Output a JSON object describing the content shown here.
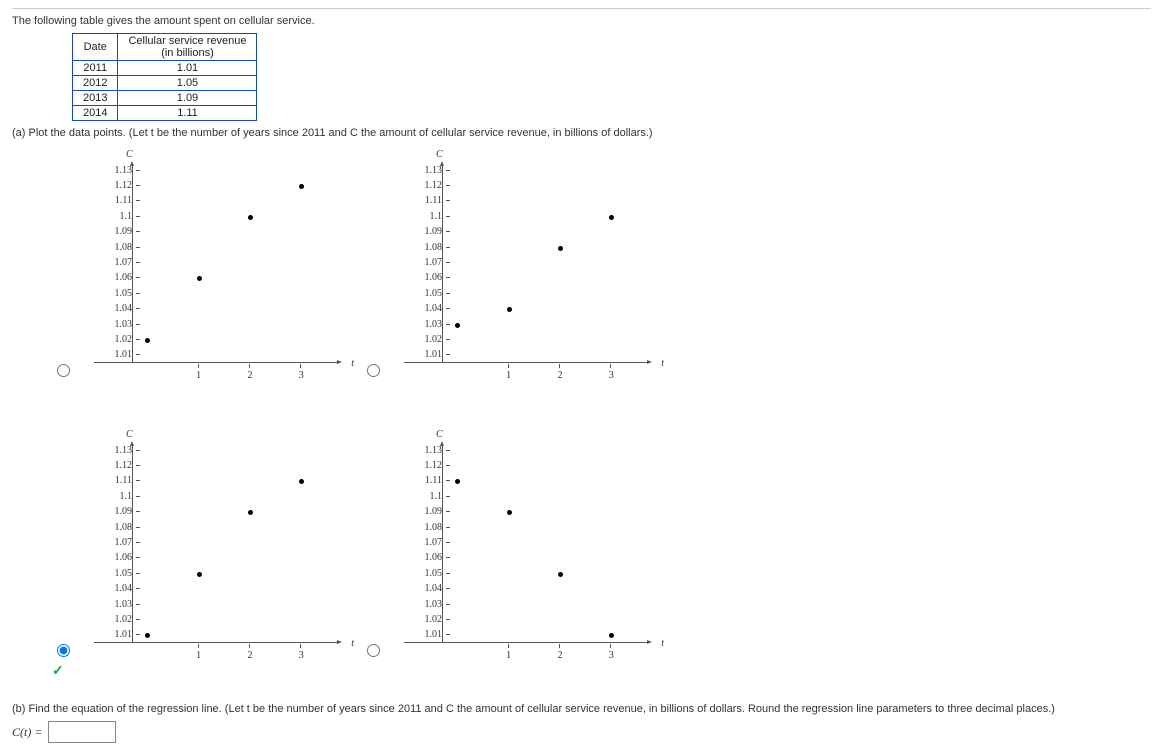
{
  "intro": "The following table gives the amount spent on cellular service.",
  "table": {
    "headers": {
      "date": "Date",
      "rev": "Cellular service revenue\n(in billions)"
    },
    "rows": [
      {
        "date": "2011",
        "rev": "1.01"
      },
      {
        "date": "2012",
        "rev": "1.05"
      },
      {
        "date": "2013",
        "rev": "1.09"
      },
      {
        "date": "2014",
        "rev": "1.11"
      }
    ]
  },
  "part_a": "(a) Plot the data points. (Let t be the number of years since 2011 and C the amount of cellular service revenue, in billions of dollars.)",
  "axis": {
    "ylabel": "C",
    "xlabel": "t",
    "yticks": [
      "1.01",
      "1.02",
      "1.03",
      "1.04",
      "1.05",
      "1.06",
      "1.07",
      "1.08",
      "1.09",
      "1.1",
      "1.11",
      "1.12",
      "1.13"
    ],
    "xticks": [
      "1",
      "2",
      "3"
    ]
  },
  "options": {
    "A": {
      "points": [
        {
          "t": 0,
          "c": 1.02
        },
        {
          "t": 1,
          "c": 1.06
        },
        {
          "t": 2,
          "c": 1.1
        },
        {
          "t": 3,
          "c": 1.12
        }
      ],
      "selected": false
    },
    "B": {
      "points": [
        {
          "t": 0,
          "c": 1.03
        },
        {
          "t": 1,
          "c": 1.04
        },
        {
          "t": 2,
          "c": 1.08
        },
        {
          "t": 3,
          "c": 1.1
        }
      ],
      "selected": false
    },
    "C": {
      "points": [
        {
          "t": 0,
          "c": 1.01
        },
        {
          "t": 1,
          "c": 1.05
        },
        {
          "t": 2,
          "c": 1.09
        },
        {
          "t": 3,
          "c": 1.11
        }
      ],
      "selected": true
    },
    "D": {
      "points": [
        {
          "t": 0,
          "c": 1.11
        },
        {
          "t": 1,
          "c": 1.09
        },
        {
          "t": 2,
          "c": 1.05
        },
        {
          "t": 3,
          "c": 1.01
        }
      ],
      "selected": false
    }
  },
  "part_b": "(b) Find the equation of the regression line. (Let t be the number of years since 2011 and C the amount of cellular service revenue, in billions of dollars. Round the regression line parameters to three decimal places.)",
  "eq_label": "C(t) =",
  "answer": "",
  "chart_data": [
    {
      "type": "scatter",
      "title": "Option A",
      "xlabel": "t",
      "ylabel": "C",
      "xlim": [
        0,
        3.5
      ],
      "ylim": [
        1.0,
        1.14
      ],
      "x": [
        0,
        1,
        2,
        3
      ],
      "y": [
        1.02,
        1.06,
        1.1,
        1.12
      ]
    },
    {
      "type": "scatter",
      "title": "Option B",
      "xlabel": "t",
      "ylabel": "C",
      "xlim": [
        0,
        3.5
      ],
      "ylim": [
        1.0,
        1.14
      ],
      "x": [
        0,
        1,
        2,
        3
      ],
      "y": [
        1.03,
        1.04,
        1.08,
        1.1
      ]
    },
    {
      "type": "scatter",
      "title": "Option C",
      "xlabel": "t",
      "ylabel": "C",
      "xlim": [
        0,
        3.5
      ],
      "ylim": [
        1.0,
        1.14
      ],
      "x": [
        0,
        1,
        2,
        3
      ],
      "y": [
        1.01,
        1.05,
        1.09,
        1.11
      ]
    },
    {
      "type": "scatter",
      "title": "Option D",
      "xlabel": "t",
      "ylabel": "C",
      "xlim": [
        0,
        3.5
      ],
      "ylim": [
        1.0,
        1.14
      ],
      "x": [
        0,
        1,
        2,
        3
      ],
      "y": [
        1.11,
        1.09,
        1.05,
        1.01
      ]
    }
  ]
}
